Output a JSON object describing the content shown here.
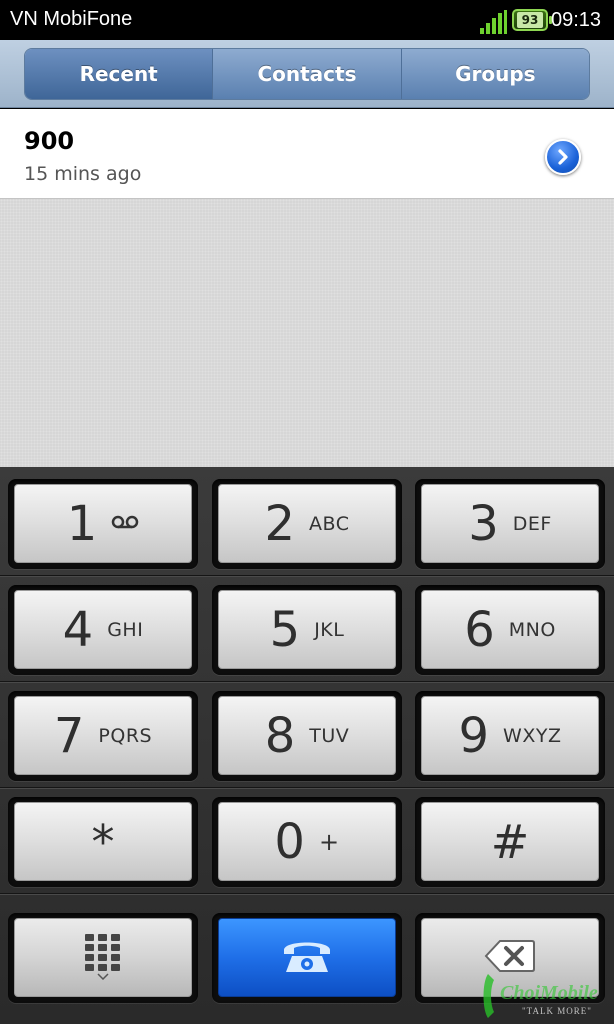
{
  "status_bar": {
    "carrier": "VN MobiFone",
    "battery_level": "93",
    "time": "09:13",
    "signal_color": "#6fd12f"
  },
  "tabs": [
    {
      "label": "Recent",
      "active": true
    },
    {
      "label": "Contacts",
      "active": false
    },
    {
      "label": "Groups",
      "active": false
    }
  ],
  "recent_calls": [
    {
      "number": "900",
      "time": "15 mins ago",
      "detail_icon": "chevron-right-icon"
    }
  ],
  "keypad": {
    "keys": [
      {
        "digit": "1",
        "letters": "",
        "icon": "voicemail-icon"
      },
      {
        "digit": "2",
        "letters": "ABC"
      },
      {
        "digit": "3",
        "letters": "DEF"
      },
      {
        "digit": "4",
        "letters": "GHI"
      },
      {
        "digit": "5",
        "letters": "JKL"
      },
      {
        "digit": "6",
        "letters": "MNO"
      },
      {
        "digit": "7",
        "letters": "PQRS"
      },
      {
        "digit": "8",
        "letters": "TUV"
      },
      {
        "digit": "9",
        "letters": "WXYZ"
      },
      {
        "digit": "*",
        "letters": ""
      },
      {
        "digit": "0",
        "letters": "+"
      },
      {
        "digit": "#",
        "letters": ""
      }
    ],
    "bottom_row": [
      {
        "name": "hide-keypad",
        "icon": "keypad-grid-icon"
      },
      {
        "name": "call",
        "icon": "phone-handset-icon",
        "color": "#1f6fe8"
      },
      {
        "name": "backspace",
        "icon": "backspace-icon"
      }
    ]
  },
  "watermark": {
    "brand": "ChoiMobile",
    "tagline": "\"TALK MORE\""
  }
}
